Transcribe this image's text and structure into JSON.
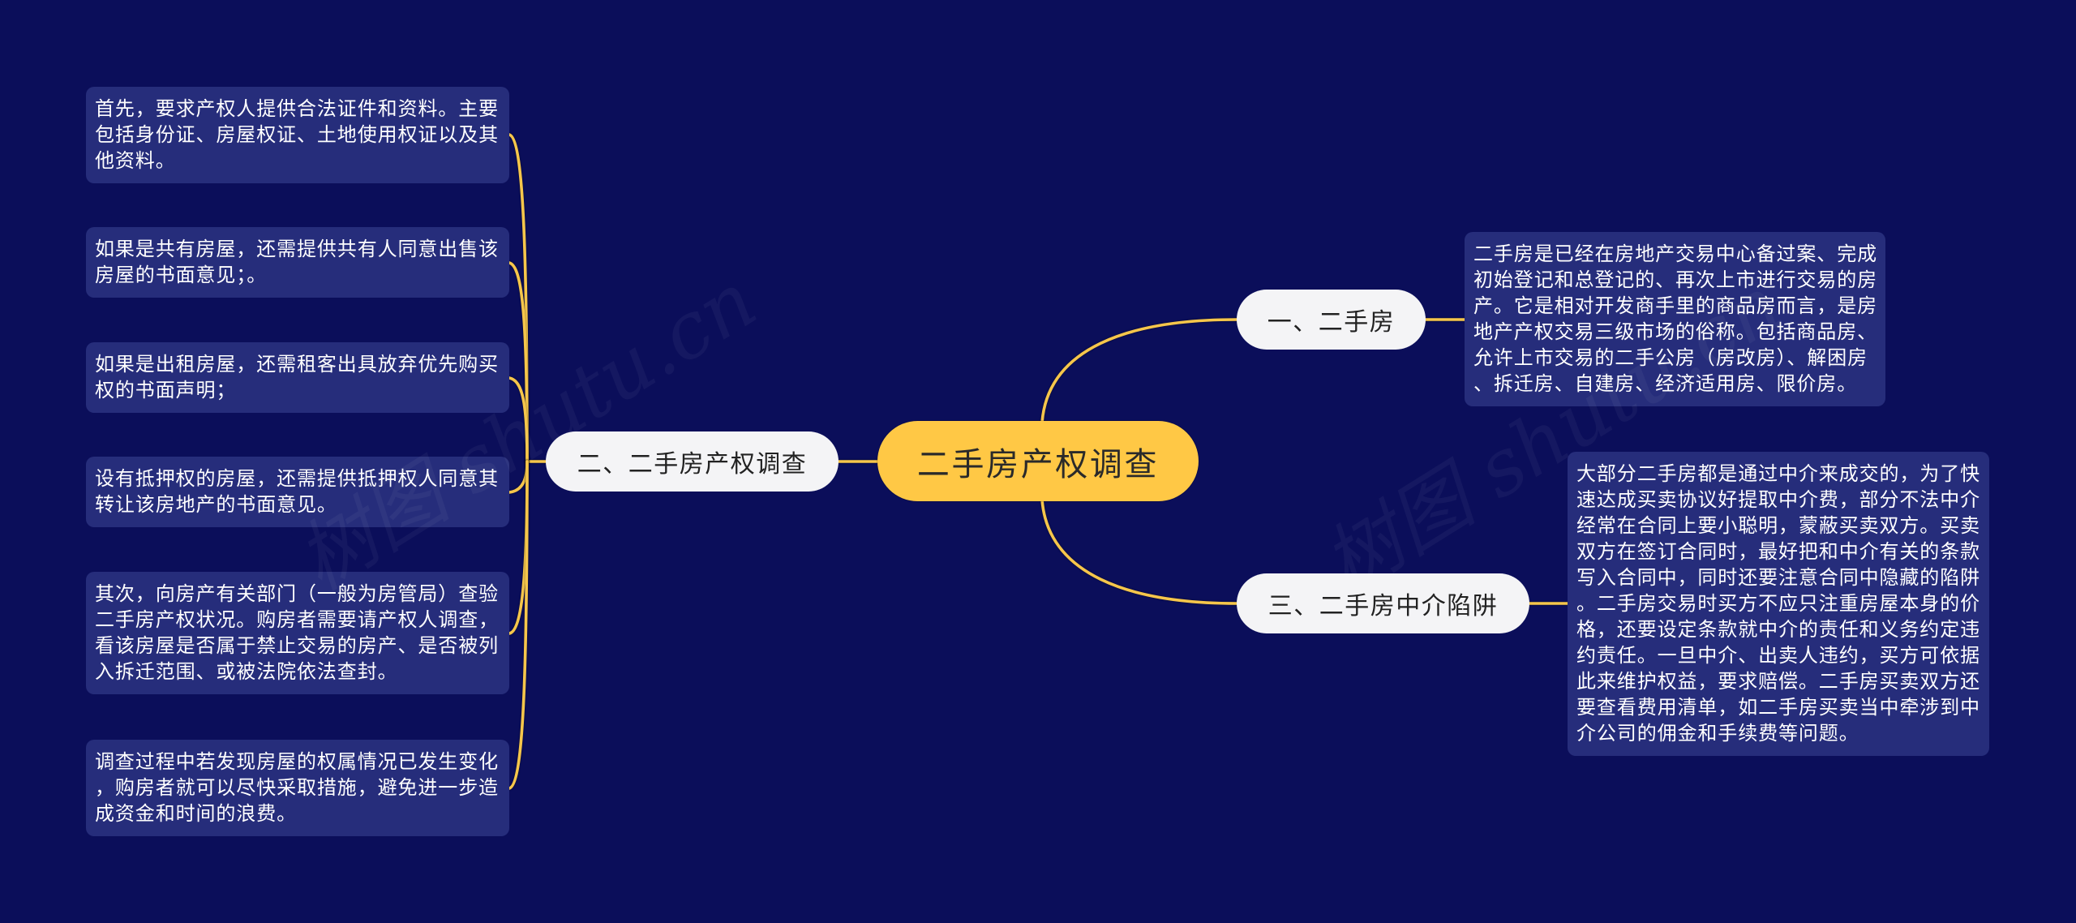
{
  "colors": {
    "background": "#0B0E5A",
    "root_fill": "#FFC845",
    "branch_fill": "#F4F4F6",
    "detail_fill": "#262D7B",
    "connector": "#F6C64B"
  },
  "watermark": "树图 shutu.cn",
  "mindmap": {
    "root": {
      "label": "二手房产权调查"
    },
    "branches": [
      {
        "label": "一、二手房",
        "details": [
          {
            "lines": [
              "二手房是已经在房地产交易中心备过案、完成",
              "初始登记和总登记的、再次上市进行交易的房",
              "产。它是相对开发商手里的商品房而言，是房",
              "地产产权交易三级市场的俗称。包括商品房、",
              "允许上市交易的二手公房（房改房）、解困房",
              "、拆迁房、自建房、经济适用房、限价房。"
            ]
          }
        ]
      },
      {
        "label": "二、二手房产权调查",
        "details": [
          {
            "lines": [
              "首先，要求产权人提供合法证件和资料。主要",
              "包括身份证、房屋权证、土地使用权证以及其",
              "他资料。"
            ]
          },
          {
            "lines": [
              "如果是共有房屋，还需提供共有人同意出售该",
              "房屋的书面意见；。"
            ]
          },
          {
            "lines": [
              "如果是出租房屋，还需租客出具放弃优先购买",
              "权的书面声明；"
            ]
          },
          {
            "lines": [
              "设有抵押权的房屋，还需提供抵押权人同意其",
              "转让该房地产的书面意见。"
            ]
          },
          {
            "lines": [
              "其次，向房产有关部门（一般为房管局）查验",
              "二手房产权状况。购房者需要请产权人调查，",
              "看该房屋是否属于禁止交易的房产、是否被列",
              "入拆迁范围、或被法院依法查封。"
            ]
          },
          {
            "lines": [
              "调查过程中若发现房屋的权属情况已发生变化",
              "，购房者就可以尽快采取措施，避免进一步造",
              "成资金和时间的浪费。"
            ]
          }
        ]
      },
      {
        "label": "三、二手房中介陷阱",
        "details": [
          {
            "lines": [
              "大部分二手房都是通过中介来成交的，为了快",
              "速达成买卖协议好提取中介费，部分不法中介",
              "经常在合同上要小聪明，蒙蔽买卖双方。买卖",
              "双方在签订合同时，最好把和中介有关的条款",
              "写入合同中，同时还要注意合同中隐藏的陷阱",
              "。二手房交易时买方不应只注重房屋本身的价",
              "格，还要设定条款就中介的责任和义务约定违",
              "约责任。一旦中介、出卖人违约，买方可依据",
              "此来维护权益，要求赔偿。二手房买卖双方还",
              "要查看费用清单，如二手房买卖当中牵涉到中",
              "介公司的佣金和手续费等问题。"
            ]
          }
        ]
      }
    ]
  }
}
